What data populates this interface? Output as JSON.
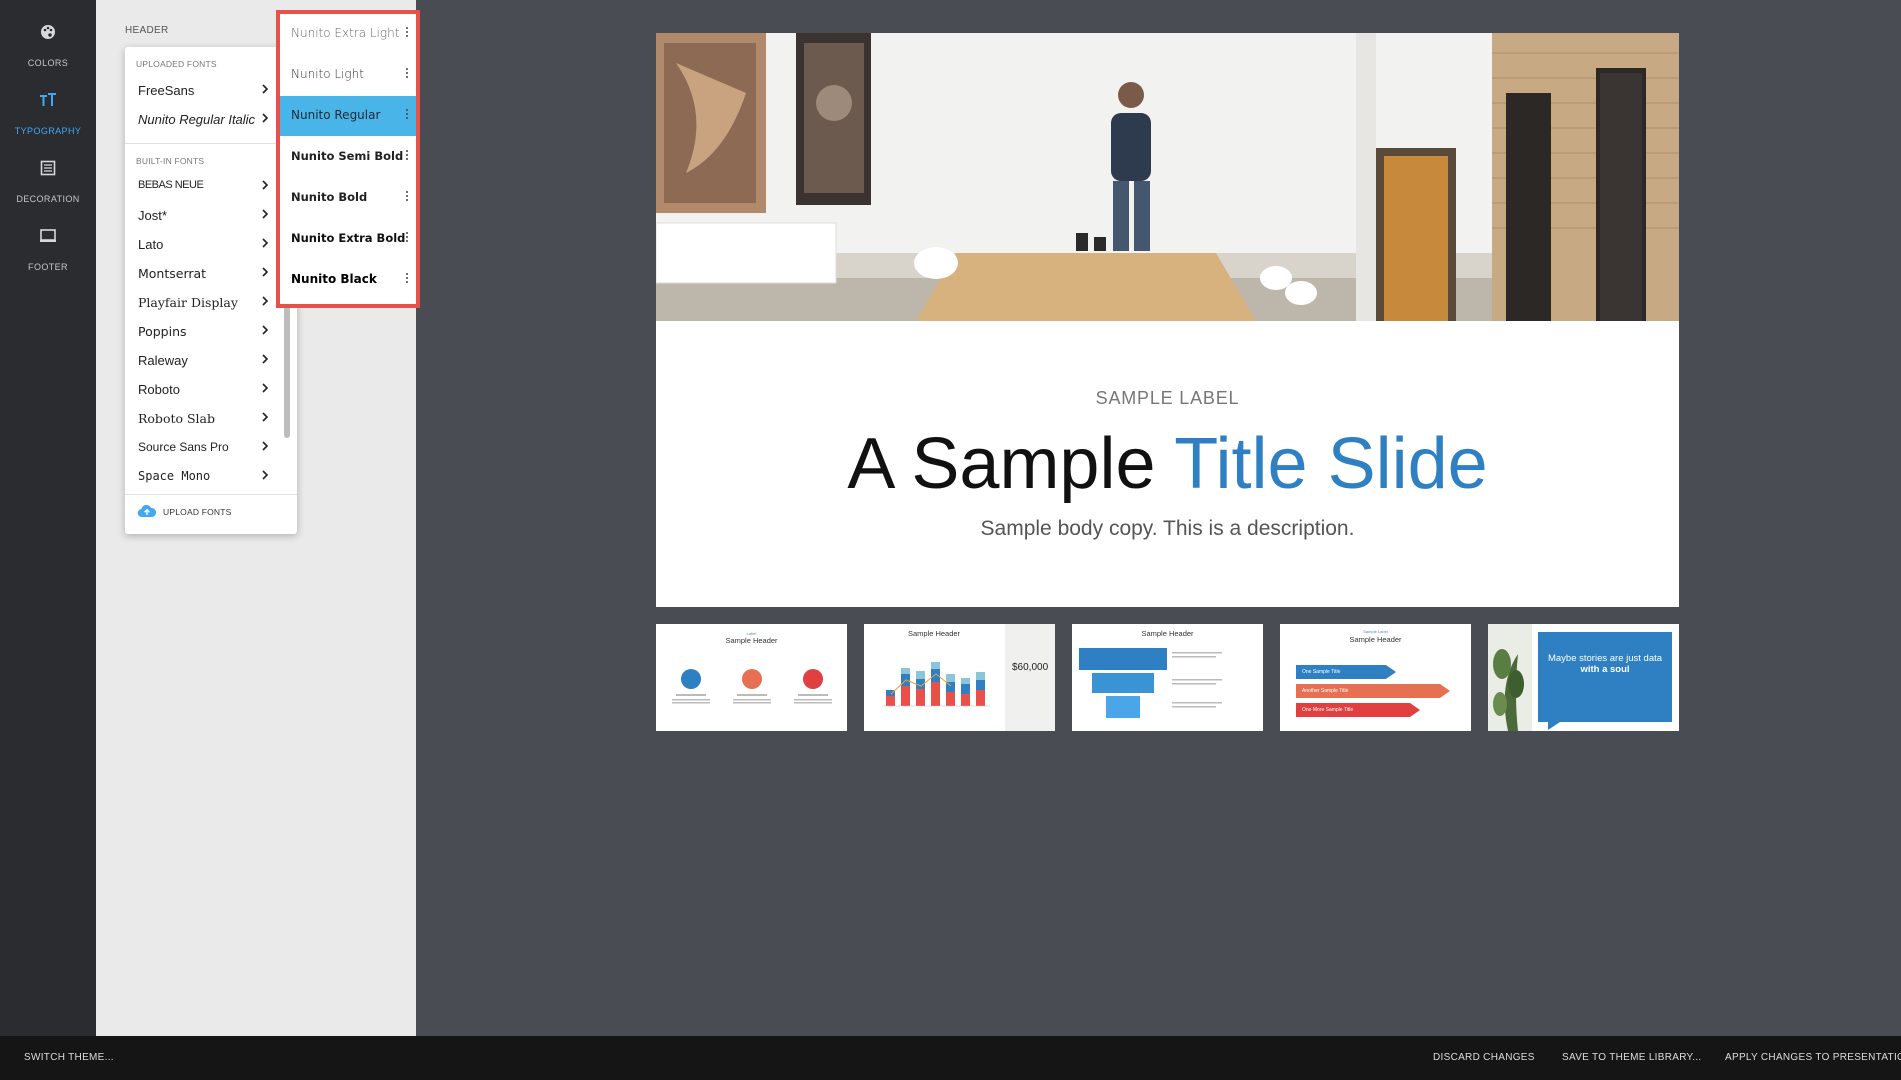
{
  "colors": {
    "rail_bg": "#2b2c2f",
    "panel_bg": "#eaeaeb",
    "canvas_bg": "#4a4c54",
    "accent": "#3fa9f5",
    "selected_weight": "#49b4e8",
    "highlight_border": "#e8504a",
    "title_accent": "#2e80c2"
  },
  "rail": {
    "items": [
      {
        "icon": "palette-icon",
        "label": "COLORS",
        "active": false
      },
      {
        "icon": "typography-icon",
        "label": "TYPOGRAPHY",
        "active": true
      },
      {
        "icon": "decoration-icon",
        "label": "DECORATION",
        "active": false
      },
      {
        "icon": "footer-icon",
        "label": "FOOTER",
        "active": false
      }
    ]
  },
  "panel": {
    "title": "HEADER"
  },
  "font_menu": {
    "uploaded_heading": "UPLOADED FONTS",
    "uploaded": [
      "FreeSans",
      "Nunito Regular Italic"
    ],
    "builtin_heading": "BUILT-IN FONTS",
    "builtin": [
      "BEBAS NEUE",
      "Jost*",
      "Lato",
      "Montserrat",
      "Playfair Display",
      "Poppins",
      "Raleway",
      "Roboto",
      "Roboto Slab",
      "Source Sans Pro",
      "Space Mono"
    ],
    "upload_label": "UPLOAD FONTS"
  },
  "weights": {
    "items": [
      "Nunito Extra Light",
      "Nunito Light",
      "Nunito Regular",
      "Nunito Semi Bold",
      "Nunito Bold",
      "Nunito Extra Bold",
      "Nunito Black"
    ],
    "selected": "Nunito Regular"
  },
  "slide": {
    "label": "SAMPLE LABEL",
    "title_plain": "A Sample",
    "title_accent": "Title Slide",
    "body": "Sample body copy. This is a description."
  },
  "thumbnails": [
    {
      "header": "Sample Header",
      "small_label": "Label"
    },
    {
      "header": "Sample Header",
      "stat": "$60,000"
    },
    {
      "header": "Sample Header"
    },
    {
      "header": "Sample Header",
      "small_label": "Sample Label",
      "items": [
        "One Sample Title",
        "Another Sample Title",
        "One More Sample Title"
      ]
    },
    {
      "quote_plain": "Maybe stories are just data ",
      "quote_bold": "with a soul"
    }
  ],
  "toolbar": {
    "switch_theme": "SWITCH THEME...",
    "discard": "DISCARD CHANGES",
    "save_library": "SAVE TO THEME LIBRARY...",
    "apply": "APPLY CHANGES TO PRESENTATION"
  }
}
